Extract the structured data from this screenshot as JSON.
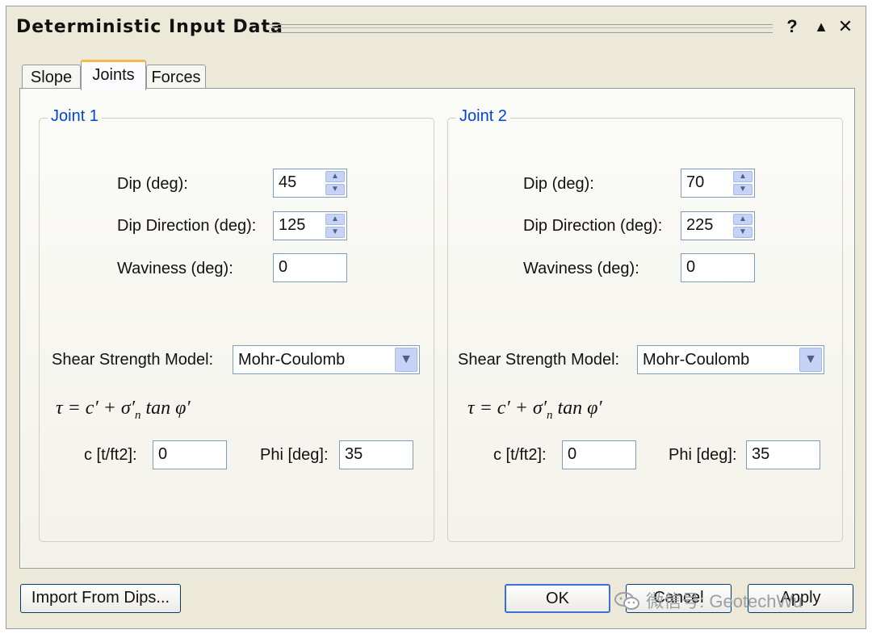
{
  "window": {
    "title": "Deterministic Input Data",
    "help_label": "?",
    "collapse_label": "▲",
    "close_label": "✕"
  },
  "tabs": [
    {
      "label": "Slope",
      "active": false
    },
    {
      "label": "Joints",
      "active": true
    },
    {
      "label": "Forces",
      "active": false
    }
  ],
  "joint1": {
    "title": "Joint 1",
    "dip_label": "Dip (deg):",
    "dip_value": "45",
    "dipdir_label": "Dip Direction (deg):",
    "dipdir_value": "125",
    "waviness_label": "Waviness (deg):",
    "waviness_value": "0",
    "model_label": "Shear Strength Model:",
    "model_value": "Mohr-Coulomb",
    "c_label": "c [t/ft2]:",
    "c_value": "0",
    "phi_label": "Phi [deg]:",
    "phi_value": "35"
  },
  "joint2": {
    "title": "Joint 2",
    "dip_label": "Dip (deg):",
    "dip_value": "70",
    "dipdir_label": "Dip Direction (deg):",
    "dipdir_value": "225",
    "waviness_label": "Waviness (deg):",
    "waviness_value": "0",
    "model_label": "Shear Strength Model:",
    "model_value": "Mohr-Coulomb",
    "c_label": "c [t/ft2]:",
    "c_value": "0",
    "phi_label": "Phi [deg]:",
    "phi_value": "35"
  },
  "formula": {
    "lhs": "τ = c′ + σ′",
    "sub": "n",
    "rhs": " tan φ′"
  },
  "buttons": {
    "import": "Import From Dips...",
    "ok": "OK",
    "cancel": "Cancel",
    "apply": "Apply"
  },
  "watermark": "微信号: GeotechWu",
  "colors": {
    "accent": "#0046d5",
    "tab_highlight": "#f6b64a",
    "window_bg": "#ece9d8"
  }
}
